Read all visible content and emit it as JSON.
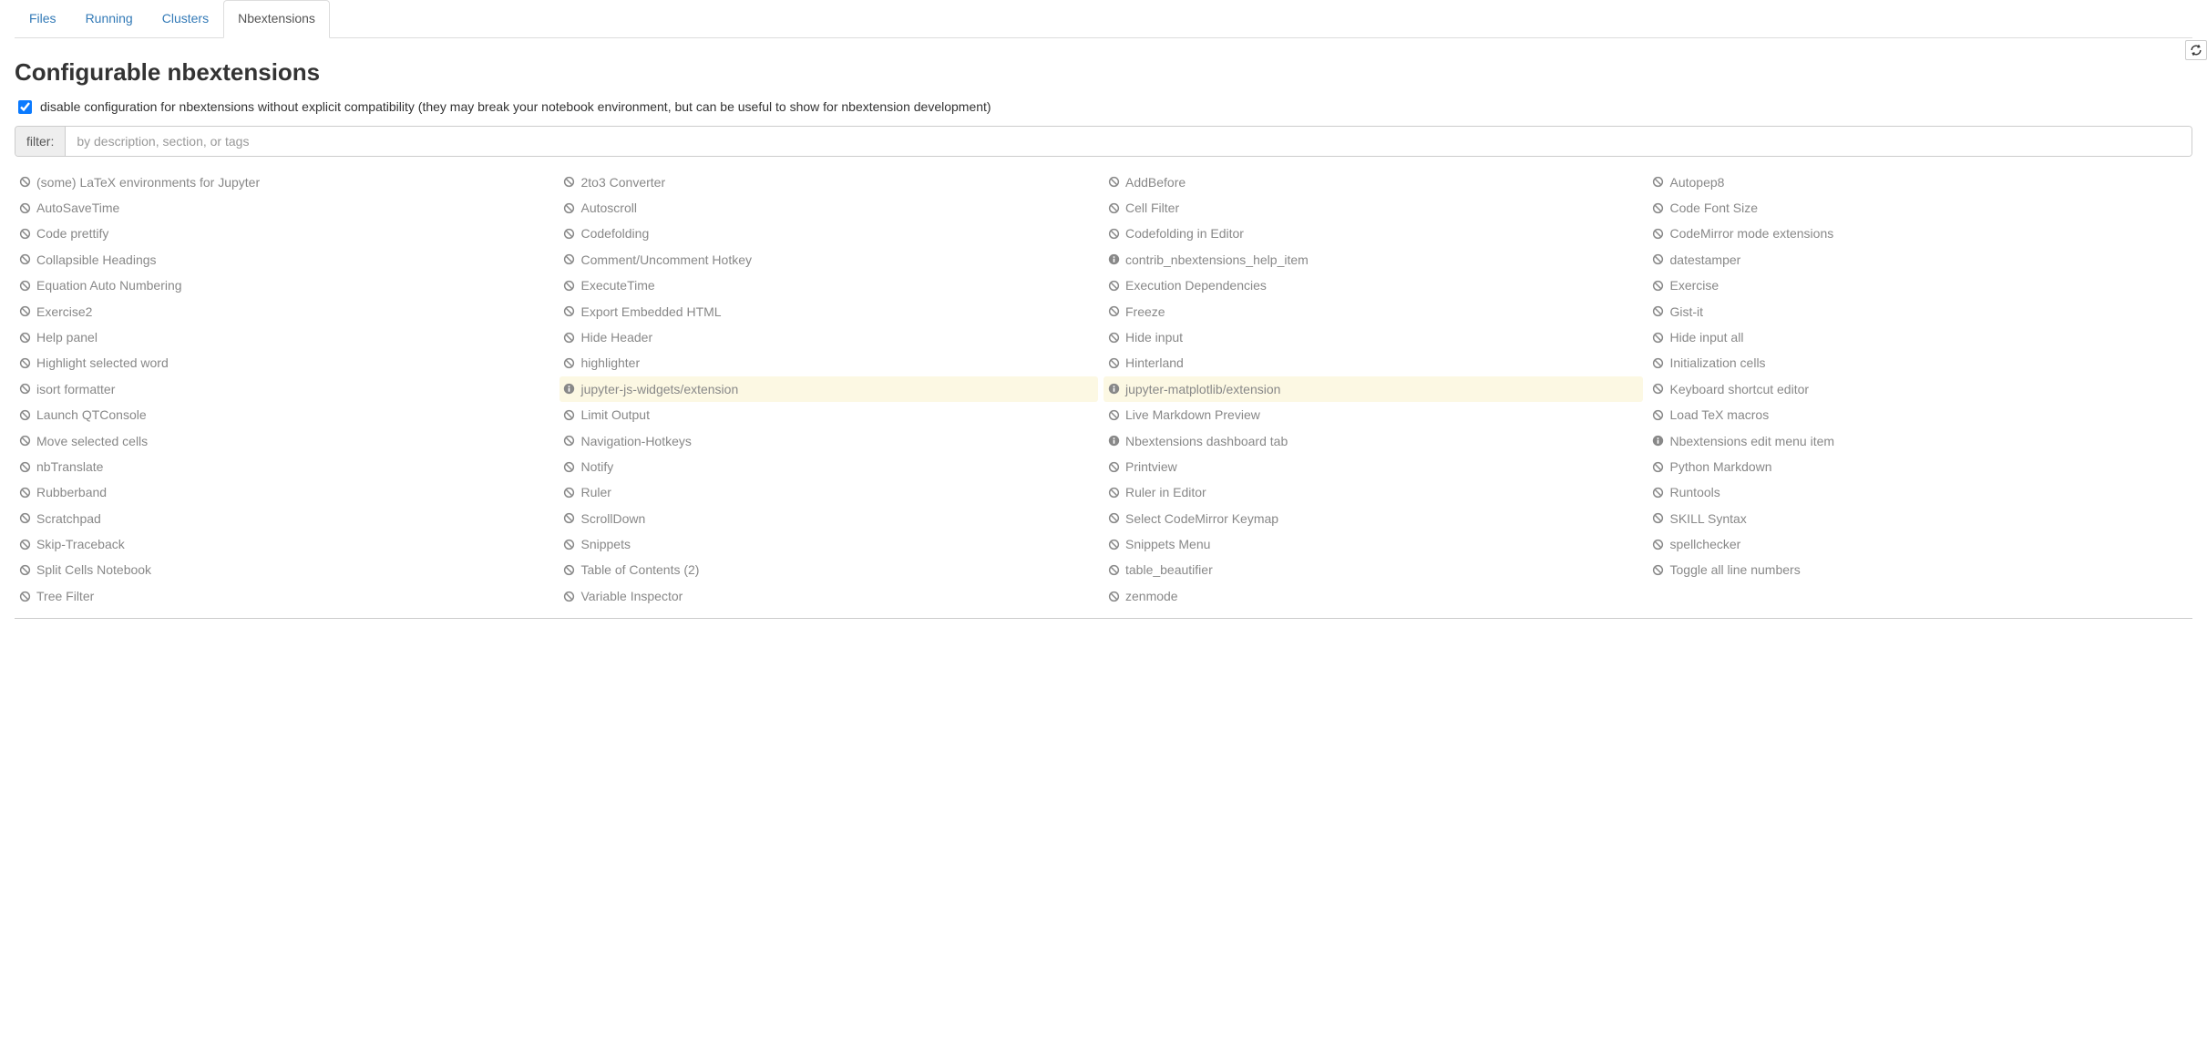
{
  "tabs": [
    {
      "label": "Files",
      "active": false
    },
    {
      "label": "Running",
      "active": false
    },
    {
      "label": "Clusters",
      "active": false
    },
    {
      "label": "Nbextensions",
      "active": true
    }
  ],
  "heading": "Configurable nbextensions",
  "compat_checkbox_label": "disable configuration for nbextensions without explicit compatibility (they may break your notebook environment, but can be useful to show for nbextension development)",
  "compat_checked": true,
  "filter": {
    "label": "filter:",
    "placeholder": "by description, section, or tags",
    "value": ""
  },
  "extensions": [
    {
      "name": "(some) LaTeX environments for Jupyter",
      "icon": "ban",
      "highlight": false
    },
    {
      "name": "2to3 Converter",
      "icon": "ban",
      "highlight": false
    },
    {
      "name": "AddBefore",
      "icon": "ban",
      "highlight": false
    },
    {
      "name": "Autopep8",
      "icon": "ban",
      "highlight": false
    },
    {
      "name": "AutoSaveTime",
      "icon": "ban",
      "highlight": false
    },
    {
      "name": "Autoscroll",
      "icon": "ban",
      "highlight": false
    },
    {
      "name": "Cell Filter",
      "icon": "ban",
      "highlight": false
    },
    {
      "name": "Code Font Size",
      "icon": "ban",
      "highlight": false
    },
    {
      "name": "Code prettify",
      "icon": "ban",
      "highlight": false
    },
    {
      "name": "Codefolding",
      "icon": "ban",
      "highlight": false
    },
    {
      "name": "Codefolding in Editor",
      "icon": "ban",
      "highlight": false
    },
    {
      "name": "CodeMirror mode extensions",
      "icon": "ban",
      "highlight": false
    },
    {
      "name": "Collapsible Headings",
      "icon": "ban",
      "highlight": false
    },
    {
      "name": "Comment/Uncomment Hotkey",
      "icon": "ban",
      "highlight": false
    },
    {
      "name": "contrib_nbextensions_help_item",
      "icon": "info",
      "highlight": false
    },
    {
      "name": "datestamper",
      "icon": "ban",
      "highlight": false
    },
    {
      "name": "Equation Auto Numbering",
      "icon": "ban",
      "highlight": false
    },
    {
      "name": "ExecuteTime",
      "icon": "ban",
      "highlight": false
    },
    {
      "name": "Execution Dependencies",
      "icon": "ban",
      "highlight": false
    },
    {
      "name": "Exercise",
      "icon": "ban",
      "highlight": false
    },
    {
      "name": "Exercise2",
      "icon": "ban",
      "highlight": false
    },
    {
      "name": "Export Embedded HTML",
      "icon": "ban",
      "highlight": false
    },
    {
      "name": "Freeze",
      "icon": "ban",
      "highlight": false
    },
    {
      "name": "Gist-it",
      "icon": "ban",
      "highlight": false
    },
    {
      "name": "Help panel",
      "icon": "ban",
      "highlight": false
    },
    {
      "name": "Hide Header",
      "icon": "ban",
      "highlight": false
    },
    {
      "name": "Hide input",
      "icon": "ban",
      "highlight": false
    },
    {
      "name": "Hide input all",
      "icon": "ban",
      "highlight": false
    },
    {
      "name": "Highlight selected word",
      "icon": "ban",
      "highlight": false
    },
    {
      "name": "highlighter",
      "icon": "ban",
      "highlight": false
    },
    {
      "name": "Hinterland",
      "icon": "ban",
      "highlight": false
    },
    {
      "name": "Initialization cells",
      "icon": "ban",
      "highlight": false
    },
    {
      "name": "isort formatter",
      "icon": "ban",
      "highlight": false
    },
    {
      "name": "jupyter-js-widgets/extension",
      "icon": "info",
      "highlight": true
    },
    {
      "name": "jupyter-matplotlib/extension",
      "icon": "info",
      "highlight": true
    },
    {
      "name": "Keyboard shortcut editor",
      "icon": "ban",
      "highlight": false
    },
    {
      "name": "Launch QTConsole",
      "icon": "ban",
      "highlight": false
    },
    {
      "name": "Limit Output",
      "icon": "ban",
      "highlight": false
    },
    {
      "name": "Live Markdown Preview",
      "icon": "ban",
      "highlight": false
    },
    {
      "name": "Load TeX macros",
      "icon": "ban",
      "highlight": false
    },
    {
      "name": "Move selected cells",
      "icon": "ban",
      "highlight": false
    },
    {
      "name": "Navigation-Hotkeys",
      "icon": "ban",
      "highlight": false
    },
    {
      "name": "Nbextensions dashboard tab",
      "icon": "info",
      "highlight": false
    },
    {
      "name": "Nbextensions edit menu item",
      "icon": "info",
      "highlight": false
    },
    {
      "name": "nbTranslate",
      "icon": "ban",
      "highlight": false
    },
    {
      "name": "Notify",
      "icon": "ban",
      "highlight": false
    },
    {
      "name": "Printview",
      "icon": "ban",
      "highlight": false
    },
    {
      "name": "Python Markdown",
      "icon": "ban",
      "highlight": false
    },
    {
      "name": "Rubberband",
      "icon": "ban",
      "highlight": false
    },
    {
      "name": "Ruler",
      "icon": "ban",
      "highlight": false
    },
    {
      "name": "Ruler in Editor",
      "icon": "ban",
      "highlight": false
    },
    {
      "name": "Runtools",
      "icon": "ban",
      "highlight": false
    },
    {
      "name": "Scratchpad",
      "icon": "ban",
      "highlight": false
    },
    {
      "name": "ScrollDown",
      "icon": "ban",
      "highlight": false
    },
    {
      "name": "Select CodeMirror Keymap",
      "icon": "ban",
      "highlight": false
    },
    {
      "name": "SKILL Syntax",
      "icon": "ban",
      "highlight": false
    },
    {
      "name": "Skip-Traceback",
      "icon": "ban",
      "highlight": false
    },
    {
      "name": "Snippets",
      "icon": "ban",
      "highlight": false
    },
    {
      "name": "Snippets Menu",
      "icon": "ban",
      "highlight": false
    },
    {
      "name": "spellchecker",
      "icon": "ban",
      "highlight": false
    },
    {
      "name": "Split Cells Notebook",
      "icon": "ban",
      "highlight": false
    },
    {
      "name": "Table of Contents (2)",
      "icon": "ban",
      "highlight": false
    },
    {
      "name": "table_beautifier",
      "icon": "ban",
      "highlight": false
    },
    {
      "name": "Toggle all line numbers",
      "icon": "ban",
      "highlight": false
    },
    {
      "name": "Tree Filter",
      "icon": "ban",
      "highlight": false
    },
    {
      "name": "Variable Inspector",
      "icon": "ban",
      "highlight": false
    },
    {
      "name": "zenmode",
      "icon": "ban",
      "highlight": false
    }
  ]
}
